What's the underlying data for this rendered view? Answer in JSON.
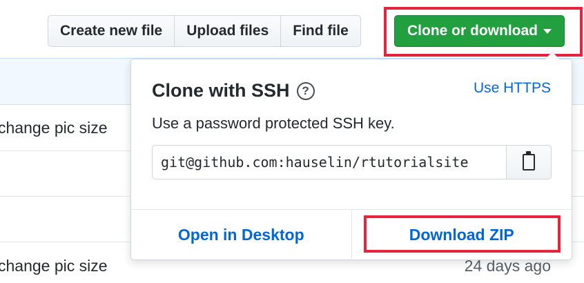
{
  "toolbar": {
    "create_label": "Create new file",
    "upload_label": "Upload files",
    "find_label": "Find file",
    "clone_label": "Clone or download"
  },
  "background": {
    "commit_messages": [
      "change pic size",
      "change pic size"
    ],
    "age": "24 days ago"
  },
  "clone_panel": {
    "title": "Clone with SSH",
    "help_symbol": "?",
    "switch_label": "Use HTTPS",
    "description": "Use a password protected SSH key.",
    "url_value": "git@github.com:hauselin/rtutorialsite",
    "open_desktop_label": "Open in Desktop",
    "download_zip_label": "Download ZIP"
  },
  "colors": {
    "clone_button": "#22a03f",
    "link": "#0366d6",
    "highlight": "#e8233c"
  },
  "icons": [
    "caret-down-icon",
    "question-icon",
    "clipboard-icon"
  ]
}
